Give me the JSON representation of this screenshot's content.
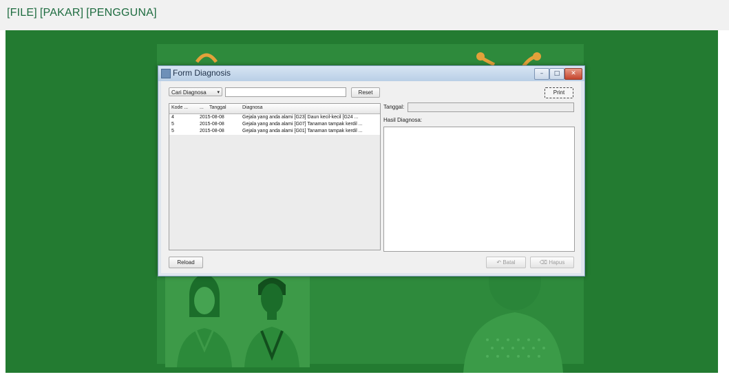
{
  "menu": {
    "items": [
      "[FILE]",
      "[PAKAR]",
      "[PENGGUNA]"
    ]
  },
  "colors": {
    "accent": "#1d6b3f",
    "desktop": "#237b31"
  },
  "window": {
    "title": "Form Diagnosis",
    "minimize": "–",
    "maximize": "□",
    "close": "✕"
  },
  "form": {
    "search_by_selected": "Cari Diagnosa",
    "search_value": "",
    "reset_label": "Reset",
    "print_label": "Print",
    "tanggal_label": "Tanggal:",
    "tanggal_value": "",
    "hasil_label": "Hasil Diagnosa:",
    "hasil_value": "",
    "reload_label": "Reload",
    "batal_label": "Batal",
    "hapus_label": "Hapus"
  },
  "table": {
    "columns": [
      "Kode ...",
      "...",
      "Tanggal",
      "Diagnosa"
    ],
    "rows": [
      {
        "kode": "4",
        "tanggal": "2015-08-08",
        "diagnosa": "Gejala yang anda alami [G23] Daun kecil-kecil [G24 ..."
      },
      {
        "kode": "5",
        "tanggal": "2015-08-08",
        "diagnosa": "Gejala yang anda alami [G07] Tanaman tampak kerdil ..."
      },
      {
        "kode": "5",
        "tanggal": "2015-08-08",
        "diagnosa": "Gejala yang anda alami [G01] Tanaman tampak kerdil ..."
      }
    ]
  }
}
